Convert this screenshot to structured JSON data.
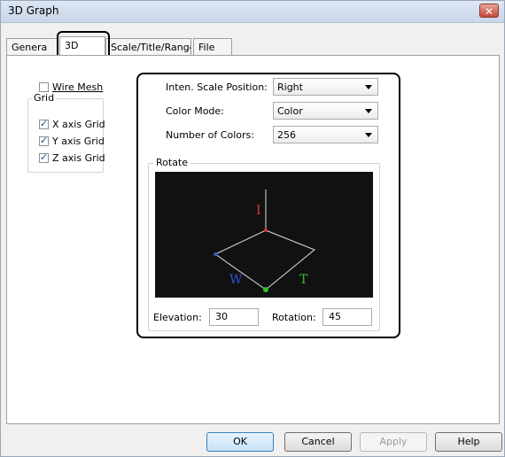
{
  "window": {
    "title": "3D Graph",
    "close_label": "✕"
  },
  "tabs": [
    {
      "label": "Genera"
    },
    {
      "label": "3D"
    },
    {
      "label": "Scale/Title/Range"
    },
    {
      "label": "File"
    }
  ],
  "left": {
    "wire_mesh": {
      "label": "Wire Mesh",
      "checked": false
    },
    "grid_group": "Grid",
    "x_axis_grid": {
      "label": "X axis Grid",
      "checked": true
    },
    "y_axis_grid": {
      "label": "Y axis Grid",
      "checked": true
    },
    "z_axis_grid": {
      "label": "Z axis Grid",
      "checked": true
    }
  },
  "settings": {
    "inten_scale_position": {
      "label": "Inten. Scale Position:",
      "value": "Right"
    },
    "color_mode": {
      "label": "Color Mode:",
      "value": "Color"
    },
    "number_of_colors": {
      "label": "Number of Colors:",
      "value": "256"
    }
  },
  "rotate": {
    "group_label": "Rotate",
    "axis_labels": {
      "i": "I",
      "w": "W",
      "t": "T"
    },
    "axis_colors": {
      "i": "#e03030",
      "w": "#3050d0",
      "t": "#30c030"
    },
    "elevation": {
      "label": "Elevation:",
      "value": "30"
    },
    "rotation": {
      "label": "Rotation:",
      "value": "45"
    }
  },
  "buttons": {
    "ok": "OK",
    "cancel": "Cancel",
    "apply": "Apply",
    "help": "Help"
  }
}
